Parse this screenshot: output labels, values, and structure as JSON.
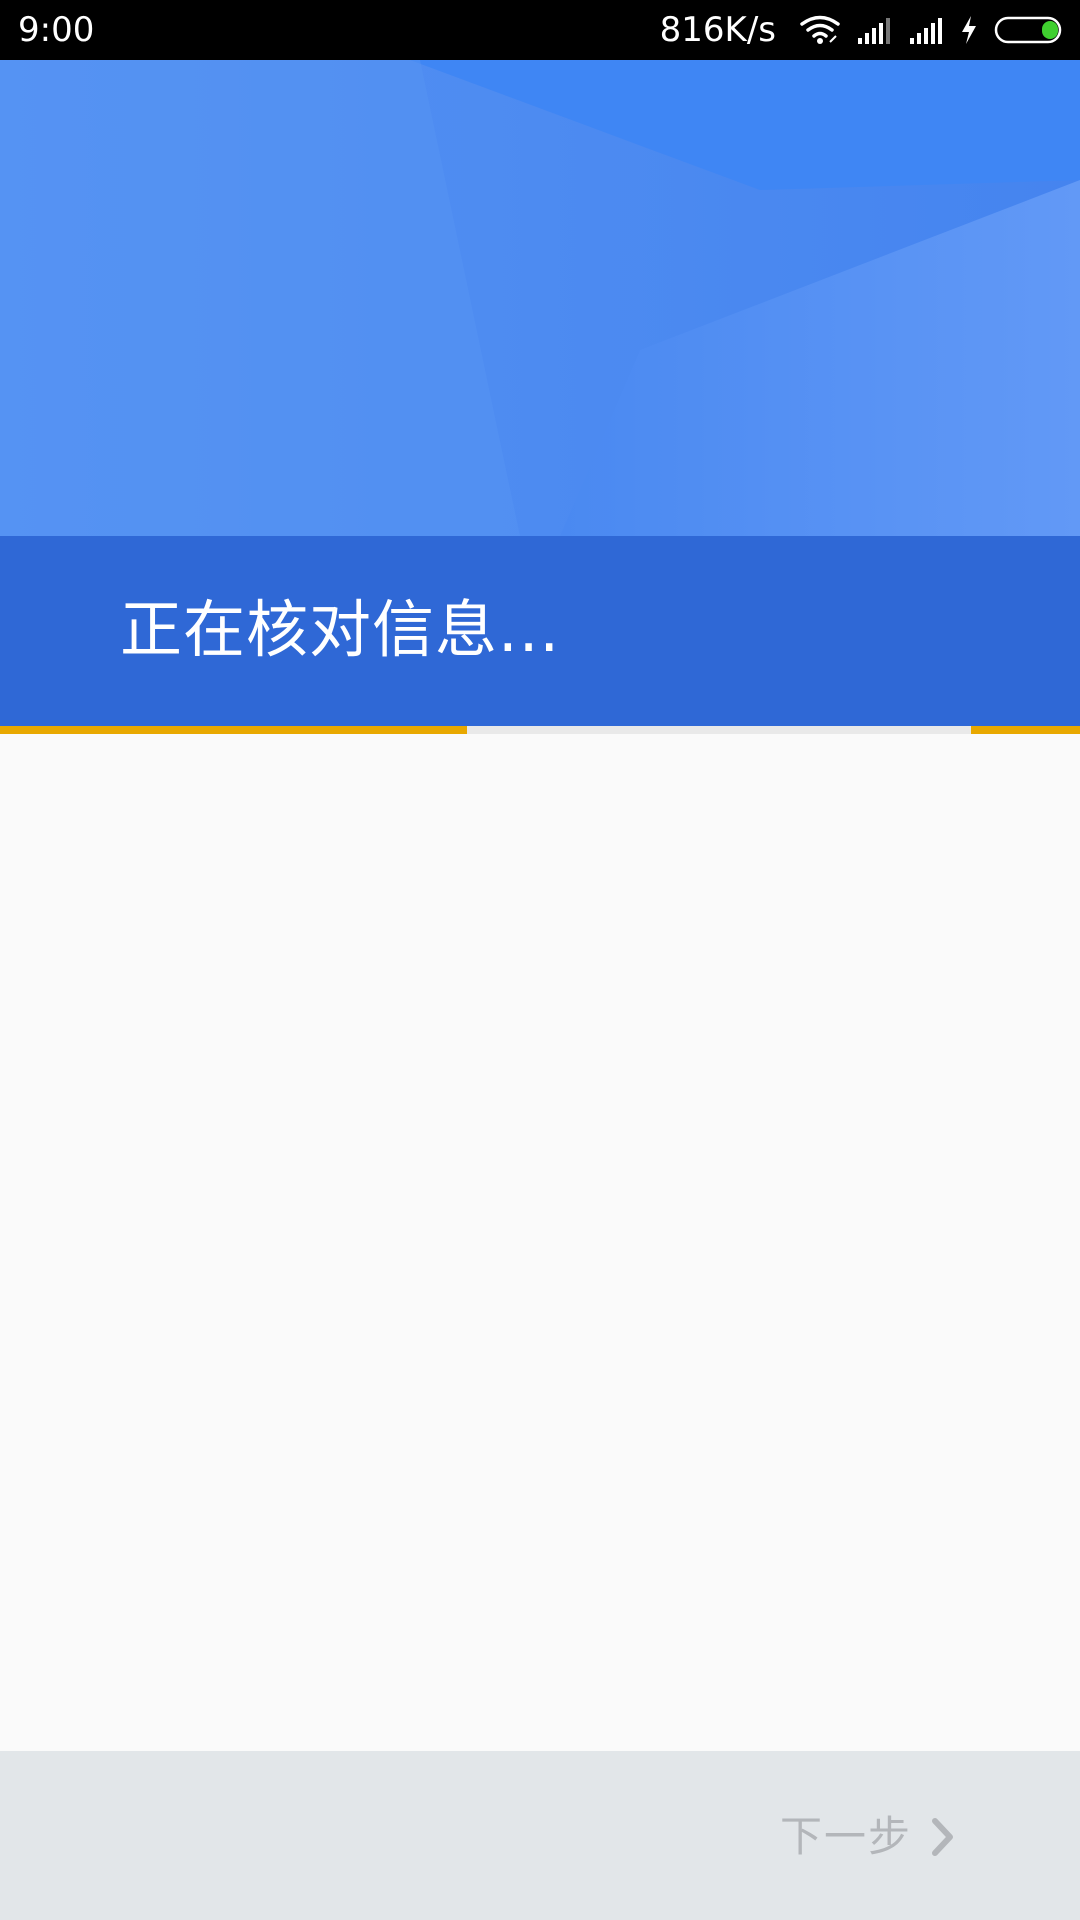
{
  "status_bar": {
    "time": "9:00",
    "network_speed": "816K/s",
    "icons": [
      "wifi-icon",
      "signal-icon",
      "signal-icon",
      "charging-icon",
      "battery-icon"
    ]
  },
  "header": {
    "title": "正在核对信息..."
  },
  "progress": {
    "segments": [
      {
        "start": 0.0,
        "end": 0.432
      },
      {
        "start": 0.899,
        "end": 1.0
      }
    ],
    "active_color": "#e8a800"
  },
  "footer": {
    "next_label": "下一步",
    "next_icon": "chevron-right-icon"
  },
  "colors": {
    "header_blue": "#4d8af0",
    "band_blue": "#2f68d6",
    "footer_bg": "#e2e6e9",
    "disabled_text": "#b3b6ba"
  }
}
